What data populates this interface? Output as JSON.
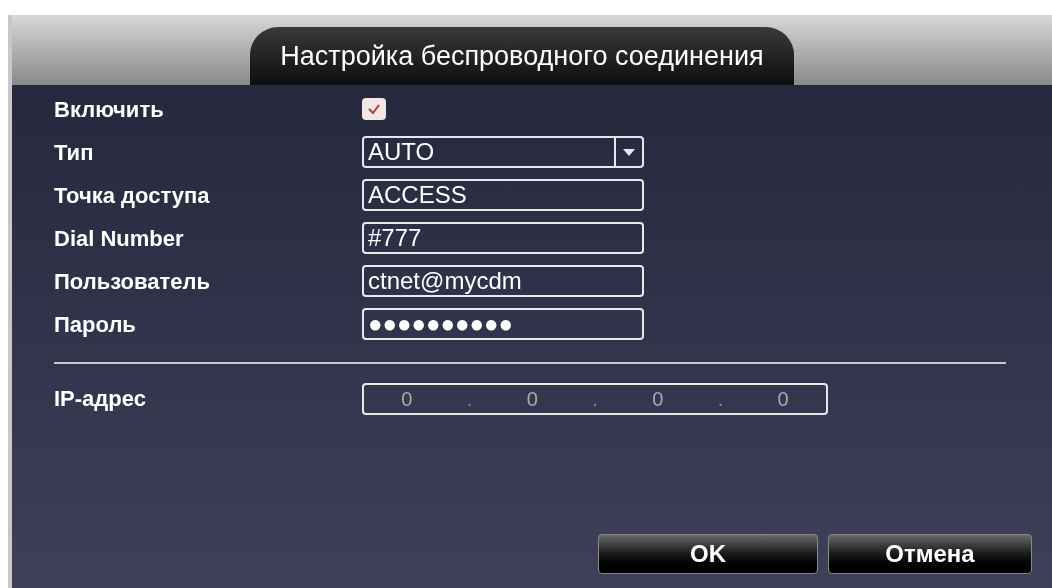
{
  "window": {
    "title": "Настройка беспроводного соединения"
  },
  "fields": [
    {
      "kind": "checkbox",
      "label": "Включить",
      "checked": true
    },
    {
      "kind": "dropdown",
      "label": "Тип",
      "value": "AUTO"
    },
    {
      "kind": "text",
      "label": "Точка доступа",
      "value": "ACCESS"
    },
    {
      "kind": "text",
      "label": "Dial Number",
      "value": "#777"
    },
    {
      "kind": "text",
      "label": "Пользователь",
      "value": "ctnet@mycdm"
    },
    {
      "kind": "text",
      "label": "Пароль",
      "value": "●●●●●●●●●●"
    }
  ],
  "ip": {
    "label": "IP-адрес",
    "parts": [
      "0",
      ".",
      "0",
      ".",
      "0",
      ".",
      "0"
    ]
  },
  "buttons": [
    "OK",
    "Отмена"
  ]
}
